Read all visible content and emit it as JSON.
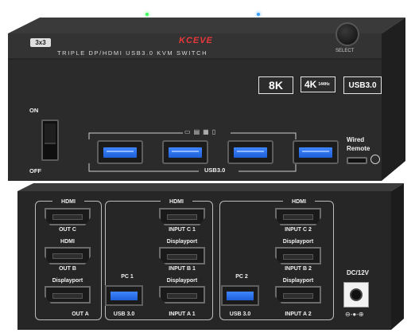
{
  "top": {
    "brand": "KCEVE",
    "model_tag": "3x3",
    "title": "TRIPLE DP/HDMI USB3.0 KVM SWITCH",
    "select_label": "SELECT",
    "badges": [
      "8K",
      "4K",
      "144Hz",
      "USB3.0"
    ],
    "power_on": "ON",
    "power_off": "OFF",
    "usb_label": "USB3.0",
    "wired_remote": "Wired\nRemote",
    "led_colors": [
      "#3cff5a",
      "#3aa0ff"
    ]
  },
  "rear": {
    "hdmi": "HDMI",
    "displayport": "Displayport",
    "out_c": "OUT C",
    "out_b": "OUT B",
    "out_a": "OUT A",
    "input_c1": "INPUT C 1",
    "input_b1": "INPUT B 1",
    "input_a1": "INPUT A 1",
    "input_c2": "INPUT C 2",
    "input_b2": "INPUT B 2",
    "input_a2": "INPUT A 2",
    "pc1": "PC 1",
    "pc2": "PC 2",
    "usb30": "USB 3.0",
    "dc": "DC/12V"
  },
  "colors": {
    "housing": "#2a2a2a",
    "usb_blue": "#2f74f0",
    "brand_red": "#e8383a"
  }
}
